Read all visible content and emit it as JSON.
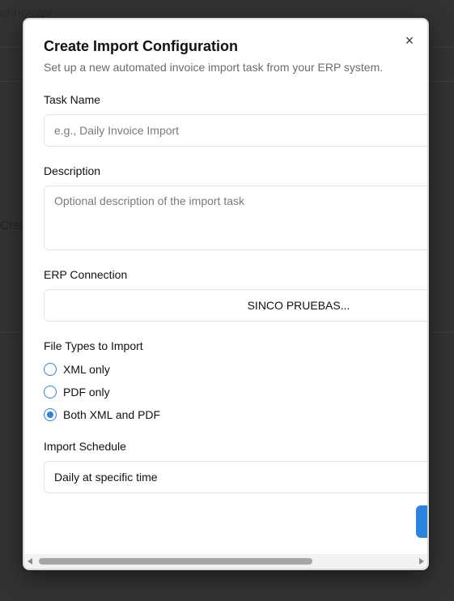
{
  "background": {
    "header_text": "chnology",
    "side_text": "Crea"
  },
  "modal": {
    "title": "Create Import Configuration",
    "subtitle": "Set up a new automated invoice import task from your ERP system.",
    "close_glyph": "×",
    "task_name": {
      "label": "Task Name",
      "value": "",
      "placeholder": "e.g., Daily Invoice Import"
    },
    "description": {
      "label": "Description",
      "value": "",
      "placeholder": "Optional description of the import task"
    },
    "erp_connection": {
      "label": "ERP Connection",
      "selected": "SINCO PRUEBAS..."
    },
    "file_types": {
      "label": "File Types to Import",
      "options": [
        {
          "label": "XML only",
          "checked": false
        },
        {
          "label": "PDF only",
          "checked": false
        },
        {
          "label": "Both XML and PDF",
          "checked": true
        }
      ]
    },
    "import_schedule": {
      "label": "Import Schedule",
      "selected": "Daily at specific time"
    }
  },
  "colors": {
    "accent": "#2a84de",
    "overlay": "#333333"
  }
}
